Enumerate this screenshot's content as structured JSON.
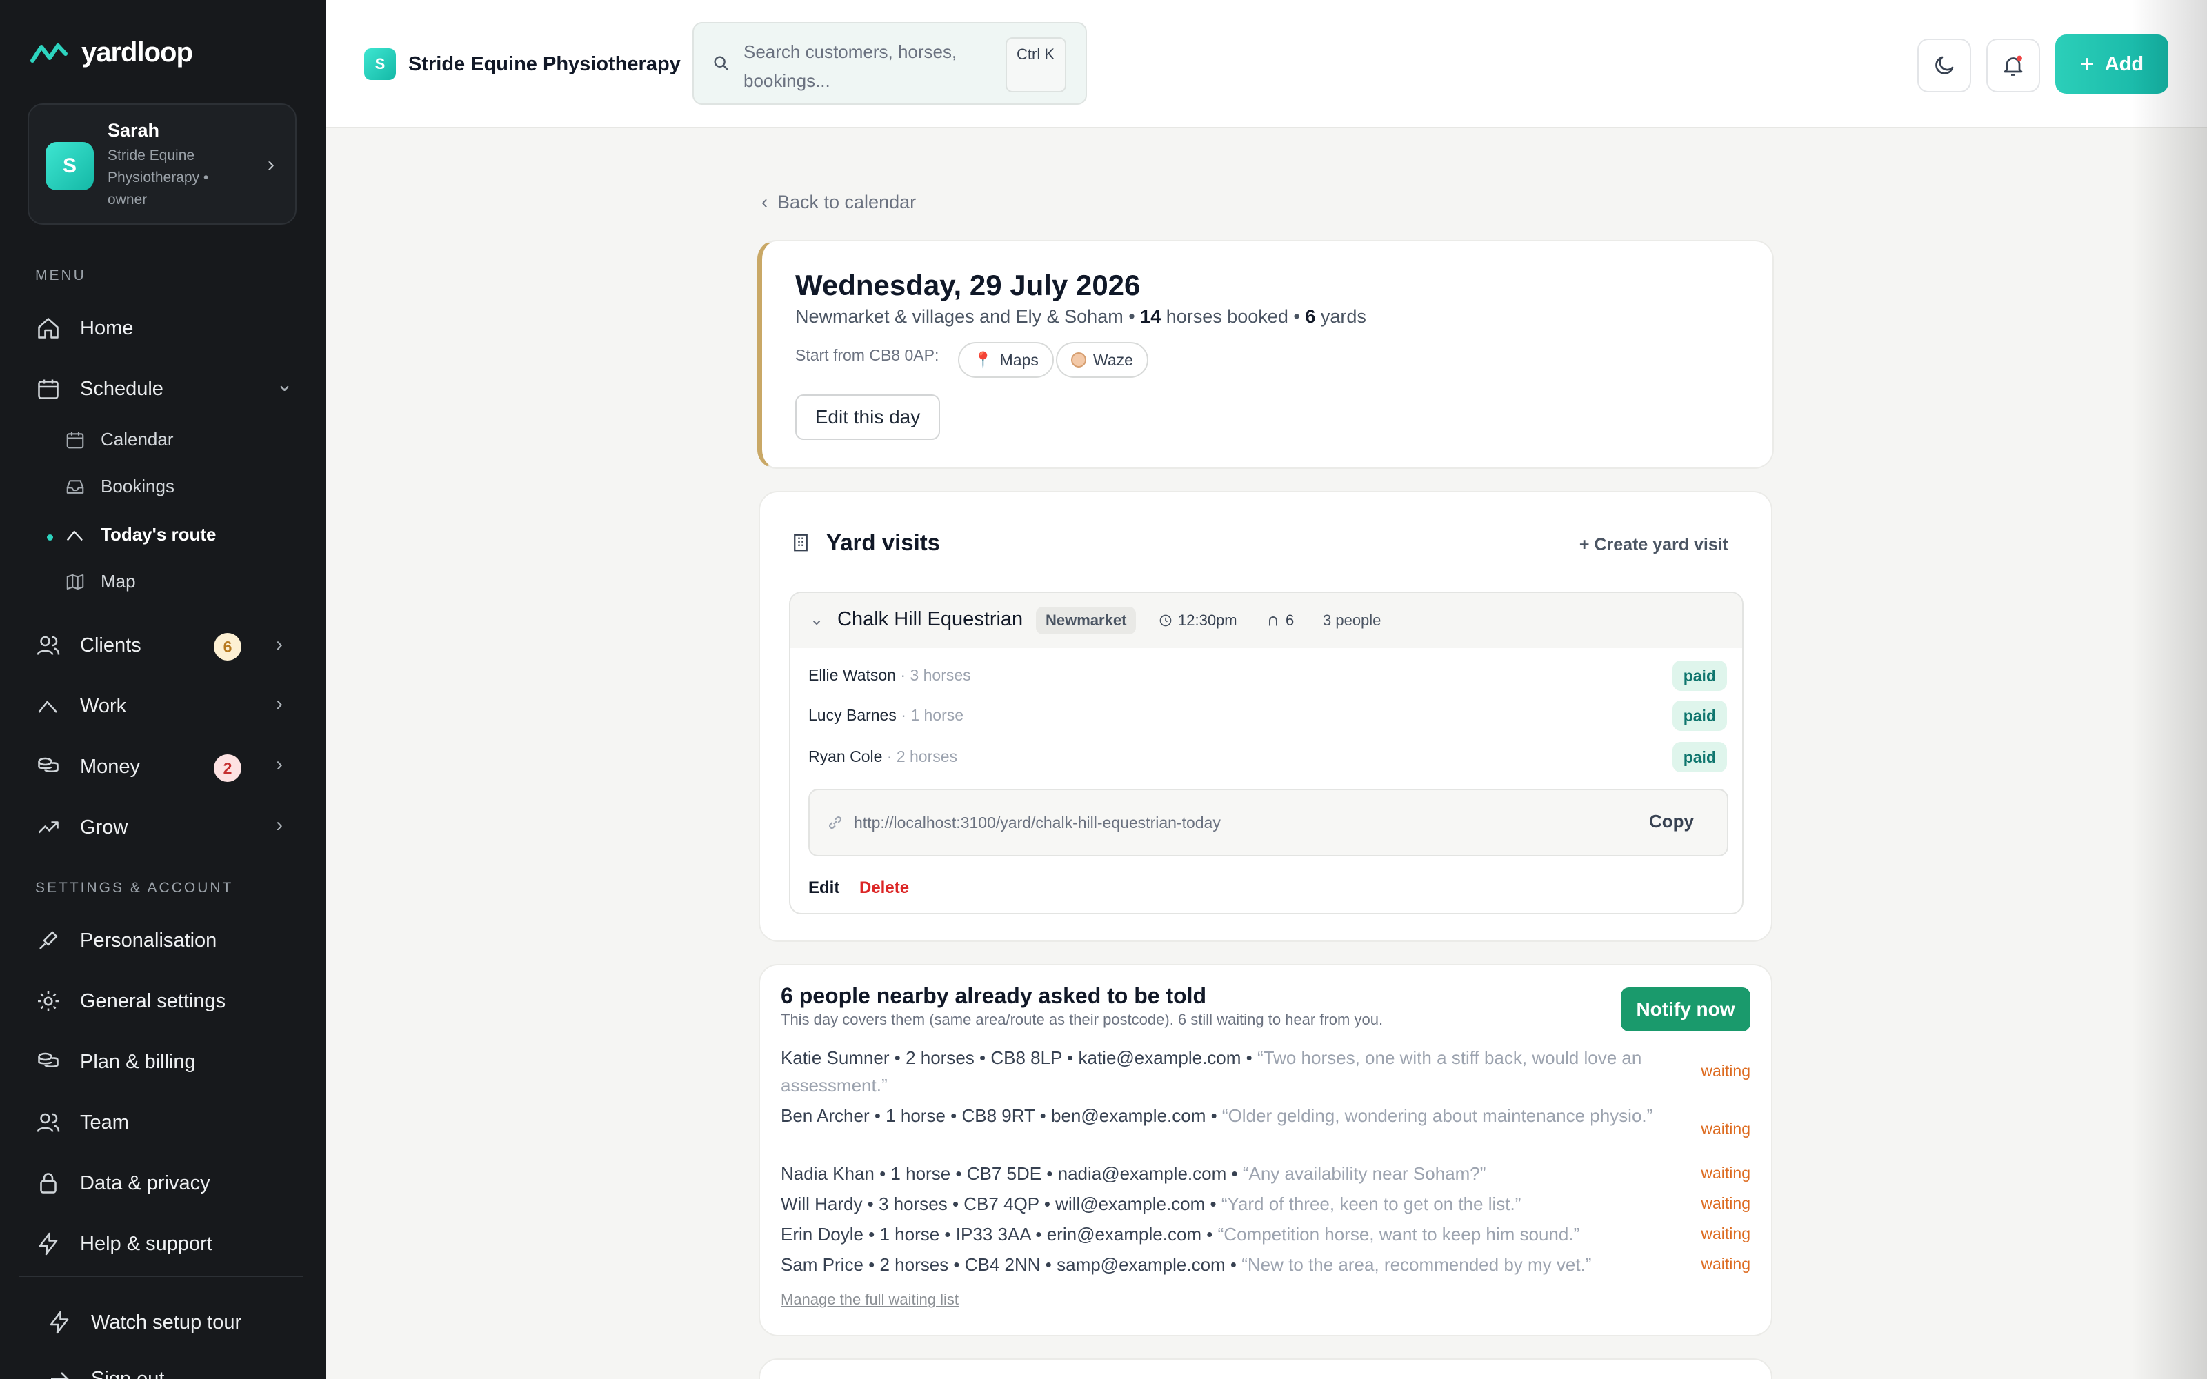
{
  "brand": {
    "name": "yardloop"
  },
  "account": {
    "initial": "S",
    "name": "Sarah",
    "org": "Stride Equine Physiotherapy • owner"
  },
  "sidebar": {
    "menu_label": "MENU",
    "settings_label": "SETTINGS & ACCOUNT",
    "home": "Home",
    "schedule": "Schedule",
    "calendar": "Calendar",
    "bookings": "Bookings",
    "todays_route": "Today's route",
    "map": "Map",
    "clients": "Clients",
    "clients_badge": "6",
    "work": "Work",
    "money": "Money",
    "money_badge": "2",
    "grow": "Grow",
    "personalisation": "Personalisation",
    "general_settings": "General settings",
    "plan_billing": "Plan & billing",
    "team": "Team",
    "data_privacy": "Data & privacy",
    "help_support": "Help & support",
    "watch_tour": "Watch setup tour",
    "sign_out": "Sign out"
  },
  "topbar": {
    "org_initial": "S",
    "org_name": "Stride Equine Physiotherapy",
    "search_placeholder": "Search customers, horses, bookings...",
    "shortcut": "Ctrl K",
    "add_label": "Add"
  },
  "day": {
    "back": "Back to calendar",
    "title": "Wednesday, 29 July 2026",
    "areas": "Newmarket & villages and Ely & Soham • ",
    "horses_count": "14",
    "horses_label": " horses booked • ",
    "yards_count": "6",
    "yards_label": " yards",
    "start_from": "Start from CB8 0AP:",
    "maps": "Maps",
    "waze": "Waze",
    "edit_day": "Edit this day"
  },
  "yard_visits": {
    "title": "Yard visits",
    "create": "+ Create yard visit",
    "yard": {
      "name": "Chalk Hill Equestrian",
      "area": "Newmarket",
      "time": "12:30pm",
      "horses": "6",
      "people": "3 people",
      "clients": [
        {
          "name": "Ellie Watson",
          "detail": " · 3 horses",
          "status": "paid"
        },
        {
          "name": "Lucy Barnes",
          "detail": " · 1 horse",
          "status": "paid"
        },
        {
          "name": "Ryan Cole",
          "detail": " · 2 horses",
          "status": "paid"
        }
      ],
      "link": "http://localhost:3100/yard/chalk-hill-equestrian-today",
      "copy": "Copy",
      "edit": "Edit",
      "delete": "Delete"
    }
  },
  "waitlist": {
    "title": "6 people nearby already asked to be told",
    "subtitle": "This day covers them (same area/route as their postcode). 6 still waiting to hear from you.",
    "notify": "Notify now",
    "entries": [
      {
        "info": "Katie Sumner • 2 horses • CB8 8LP • katie@example.com • ",
        "quote": "“Two horses, one with a stiff back, would love an assessment.”",
        "status": "waiting"
      },
      {
        "info": "Ben Archer • 1 horse • CB8 9RT • ben@example.com • ",
        "quote": "“Older gelding, wondering about maintenance physio.”",
        "status": "waiting"
      },
      {
        "info": "Nadia Khan • 1 horse • CB7 5DE • nadia@example.com • ",
        "quote": "“Any availability near Soham?”",
        "status": "waiting"
      },
      {
        "info": "Will Hardy • 3 horses • CB7 4QP • will@example.com • ",
        "quote": "“Yard of three, keen to get on the list.”",
        "status": "waiting"
      },
      {
        "info": "Erin Doyle • 1 horse • IP33 3AA • erin@example.com • ",
        "quote": "“Competition horse, want to keep him sound.”",
        "status": "waiting"
      },
      {
        "info": "Sam Price • 2 horses • CB4 2NN • samp@example.com • ",
        "quote": "“New to the area, recommended by my vet.”",
        "status": "waiting"
      }
    ],
    "manage": "Manage the full waiting list"
  },
  "colors": {
    "sidebar": "#17191c",
    "accent": "#14b8a6",
    "notify": "#1a9a6c",
    "danger": "#dc2626",
    "waiting": "#dd6b20",
    "gold": "#c9a866"
  }
}
